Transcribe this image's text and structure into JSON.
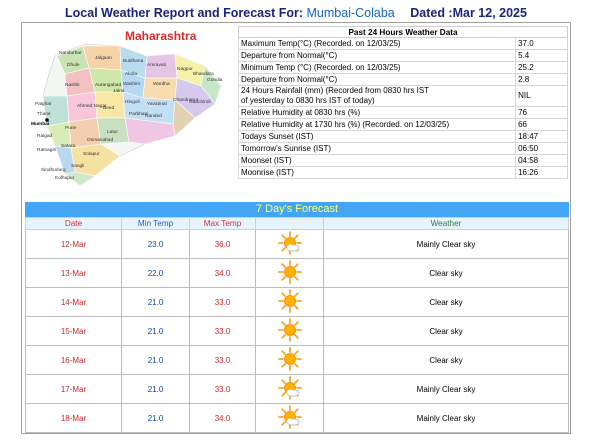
{
  "header": {
    "title": "Local Weather Report and Forecast For:",
    "location": "Mumbai-Colaba",
    "date": "Dated :Mar 12, 2025"
  },
  "map": {
    "title": "Maharashtra",
    "districts": [
      "Nandurbar",
      "Dhule",
      "Jalgaon",
      "Buldhana",
      "Amravati",
      "Akola",
      "Nagpur",
      "Bhandara",
      "Gondia",
      "Nashik",
      "Aurangabad",
      "Jalna",
      "Washim",
      "Wardha",
      "Chandrapur",
      "Gadchiroli",
      "Hingoli",
      "Yavatmal",
      "Palghar",
      "Thane",
      "Mumbai",
      "Raigad",
      "Pune",
      "Ahmed Nagar",
      "Beed",
      "Parbhani",
      "Nanded",
      "Latur",
      "Osmanabad",
      "Solapur",
      "Satara",
      "Ratnagiri",
      "Sindhudurg",
      "Kolhapur",
      "Sangli"
    ]
  },
  "past24": {
    "title": "Past 24 Hours Weather Data",
    "rows": [
      {
        "label": "Maximum Temp(°C) (Recorded. on 12/03/25)",
        "value": "37.0"
      },
      {
        "label": "Departure from Normal(°C)",
        "value": "5.4"
      },
      {
        "label": "Minimum Temp (°C) (Recorded. on 12/03/25)",
        "value": "25.2"
      },
      {
        "label": "Departure from Normal(°C)",
        "value": "2.8"
      },
      {
        "label": "24 Hours Rainfall (mm) (Recorded from 0830 hrs IST",
        "label2": "of yesterday to 0830 hrs IST of today)",
        "value": "NIL"
      },
      {
        "label": "Relative Humidity at 0830 hrs (%)",
        "value": "76"
      },
      {
        "label": "Relative Humidity at 1730 hrs (%) (Recorded. on 12/03/25)",
        "value": "66"
      },
      {
        "label": "Todays Sunset (IST)",
        "value": "18:47"
      },
      {
        "label": "Tomorrow's Sunrise (IST)",
        "value": "06:50"
      },
      {
        "label": "Moonset (IST)",
        "value": "04:58"
      },
      {
        "label": "Moonrise (IST)",
        "value": "16:26"
      }
    ]
  },
  "forecast": {
    "title": "7 Day's Forecast",
    "headers": {
      "date": "Date",
      "min": "Min Temp",
      "max": "Max Temp",
      "weather": "Weather"
    },
    "days": [
      {
        "date": "12-Mar",
        "min": "23.0",
        "max": "36.0",
        "icon": "sun-cloud-icon",
        "weather": "Mainly Clear sky"
      },
      {
        "date": "13-Mar",
        "min": "22.0",
        "max": "34.0",
        "icon": "sun-icon",
        "weather": "Clear sky"
      },
      {
        "date": "14-Mar",
        "min": "21.0",
        "max": "33.0",
        "icon": "sun-icon",
        "weather": "Clear sky"
      },
      {
        "date": "15-Mar",
        "min": "21.0",
        "max": "33.0",
        "icon": "sun-icon",
        "weather": "Clear sky"
      },
      {
        "date": "16-Mar",
        "min": "21.0",
        "max": "33.0",
        "icon": "sun-icon",
        "weather": "Clear sky"
      },
      {
        "date": "17-Mar",
        "min": "21.0",
        "max": "33.0",
        "icon": "sun-cloud-icon",
        "weather": "Mainly Clear sky"
      },
      {
        "date": "18-Mar",
        "min": "21.0",
        "max": "34.0",
        "icon": "sun-cloud-icon",
        "weather": "Mainly Clear sky"
      }
    ]
  },
  "colors": {
    "title_text": "#1a237e",
    "forecast_banner": "#42a5f5",
    "forecast_banner_text": "#ffff66",
    "map_title": "#d32f2f"
  }
}
